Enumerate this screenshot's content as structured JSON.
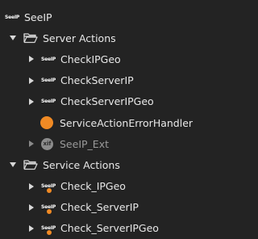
{
  "tree": {
    "root": {
      "label": "SeeIP",
      "icon": "seeip-logo-icon",
      "logo_text": "SeeIP"
    },
    "server_actions": {
      "label": "Server Actions",
      "icon": "folder-open-icon",
      "items": [
        {
          "label": "CheckIPGeo",
          "icon": "seeip-logo-icon",
          "logo_text": "SeeIP"
        },
        {
          "label": "CheckServerIP",
          "icon": "seeip-logo-icon",
          "logo_text": "SeeIP"
        },
        {
          "label": "CheckServerIPGeo",
          "icon": "seeip-logo-icon",
          "logo_text": "SeeIP"
        },
        {
          "label": "ServiceActionErrorHandler",
          "icon": "orange-dot-icon"
        },
        {
          "label": "SeeIP_Ext",
          "icon": "xif-icon",
          "icon_text": "xif"
        }
      ]
    },
    "service_actions": {
      "label": "Service Actions",
      "icon": "folder-open-icon",
      "items": [
        {
          "label": "Check_IPGeo",
          "icon": "seeip-logo-badge-icon",
          "logo_text": "SeeIP"
        },
        {
          "label": "Check_ServerIP",
          "icon": "seeip-logo-badge-icon",
          "logo_text": "SeeIP"
        },
        {
          "label": "Check_ServerIPGeo",
          "icon": "seeip-logo-badge-icon",
          "logo_text": "SeeIP"
        }
      ]
    }
  },
  "colors": {
    "background": "#232323",
    "text": "#e8e8e8",
    "dim_text": "#9a9a9a",
    "accent_orange": "#f08a24",
    "xif_gray": "#8c8c8c"
  }
}
